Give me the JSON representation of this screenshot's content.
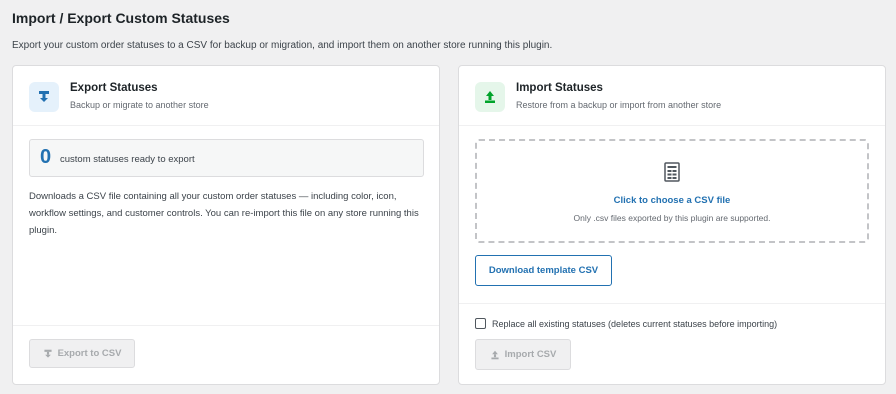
{
  "page": {
    "title": "Import / Export Custom Statuses",
    "description": "Export your custom order statuses to a CSV for backup or migration, and import them on another store running this plugin."
  },
  "export": {
    "title": "Export Statuses",
    "subtitle": "Backup or migrate to another store",
    "count": "0",
    "count_label": "custom statuses ready to export",
    "description": "Downloads a CSV file containing all your custom order statuses — including color, icon, workflow settings, and customer controls. You can re-import this file on any store running this plugin.",
    "button_label": "Export to CSV",
    "icon": "download-icon"
  },
  "import": {
    "title": "Import Statuses",
    "subtitle": "Restore from a backup or import from another store",
    "dropzone_title": "Click to choose a CSV file",
    "dropzone_sub": "Only .csv files exported by this plugin are supported.",
    "template_button": "Download template CSV",
    "replace_label": "Replace all existing statuses (deletes current statuses before importing)",
    "replace_checked": false,
    "button_label": "Import CSV",
    "icon": "upload-icon"
  },
  "colors": {
    "accent": "#2271b1",
    "export_icon_bg": "#e5f1fb",
    "import_icon_bg": "#e5f6ea",
    "import_green": "#00a32a",
    "disabled": "#a7aaad"
  }
}
